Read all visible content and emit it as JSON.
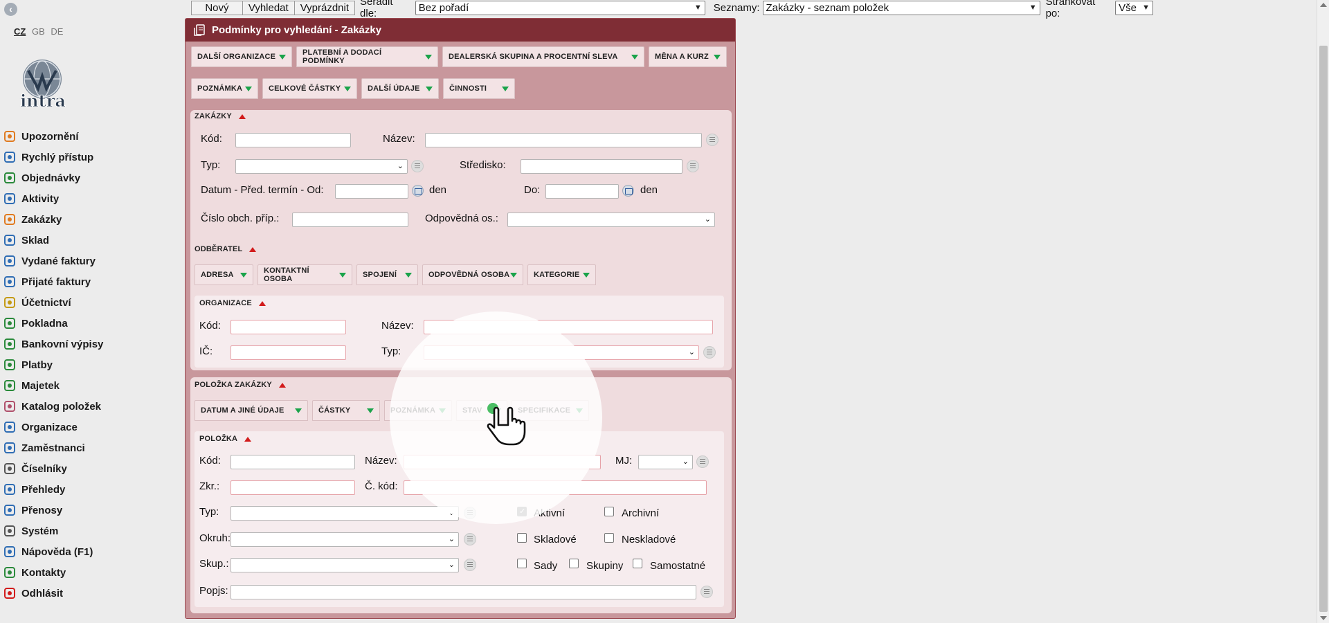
{
  "sidebar": {
    "languages": [
      "CZ",
      "GB",
      "DE"
    ],
    "active_language": "CZ",
    "logo_text": "intra",
    "items": [
      {
        "label": "Upozornění",
        "icon": "bell-icon",
        "color": "#e07a1f"
      },
      {
        "label": "Rychlý přístup",
        "icon": "tiles-icon",
        "color": "#2f6db4"
      },
      {
        "label": "Objednávky",
        "icon": "cart-icon",
        "color": "#2a8a3b"
      },
      {
        "label": "Aktivity",
        "icon": "clock-icon",
        "color": "#2f6db4"
      },
      {
        "label": "Zakázky",
        "icon": "order-icon",
        "color": "#e07a1f"
      },
      {
        "label": "Sklad",
        "icon": "warehouse-icon",
        "color": "#2f6db4"
      },
      {
        "label": "Vydané faktury",
        "icon": "invoice-out-icon",
        "color": "#2f6db4"
      },
      {
        "label": "Přijaté faktury",
        "icon": "invoice-in-icon",
        "color": "#2f6db4"
      },
      {
        "label": "Účetnictví",
        "icon": "ledger-icon",
        "color": "#c49a12"
      },
      {
        "label": "Pokladna",
        "icon": "cashbox-icon",
        "color": "#2a8a3b"
      },
      {
        "label": "Bankovní výpisy",
        "icon": "bank-icon",
        "color": "#2a8a3b"
      },
      {
        "label": "Platby",
        "icon": "coins-icon",
        "color": "#2a8a3b"
      },
      {
        "label": "Majetek",
        "icon": "assets-icon",
        "color": "#2a8a3b"
      },
      {
        "label": "Katalog položek",
        "icon": "tag-icon",
        "color": "#b0506b"
      },
      {
        "label": "Organizace",
        "icon": "building-icon",
        "color": "#2f6db4"
      },
      {
        "label": "Zaměstnanci",
        "icon": "employee-icon",
        "color": "#2f6db4"
      },
      {
        "label": "Číselníky",
        "icon": "gear-icon",
        "color": "#555555"
      },
      {
        "label": "Přehledy",
        "icon": "list-icon",
        "color": "#2f6db4"
      },
      {
        "label": "Přenosy",
        "icon": "sync-icon",
        "color": "#2f6db4"
      },
      {
        "label": "Systém",
        "icon": "wrench-icon",
        "color": "#555555"
      },
      {
        "label": "Nápověda (F1)",
        "icon": "help-icon",
        "color": "#2f6db4"
      },
      {
        "label": "Kontakty",
        "icon": "at-icon",
        "color": "#2a8a3b"
      },
      {
        "label": "Odhlásit",
        "icon": "power-icon",
        "color": "#d21b1b"
      }
    ]
  },
  "toolbar": {
    "new_label": "Nový",
    "search_label": "Vyhledat",
    "clear_label": "Vyprázdnit",
    "sort_label": "Seřadit dle:",
    "sort_value": "Bez pořadí",
    "lists_label": "Seznamy:",
    "lists_value": "Zakázky - seznam položek",
    "paging_label": "Stránkovat po:",
    "paging_value": "Vše"
  },
  "panel": {
    "title": "Podmínky pro vyhledání - Zakázky",
    "tabs_row1": [
      "Další organizace",
      "Platební a dodací podmínky",
      "Dealerská skupina a procentní sleva",
      "Měna a kurz"
    ],
    "tabs_row2": [
      "Poznámka",
      "Celkové částky",
      "Další údaje",
      "Činnosti"
    ],
    "orders": {
      "title": "ZAKÁZKY",
      "code_label": "Kód:",
      "name_label": "Název:",
      "type_label": "Typ:",
      "center_label": "Středisko:",
      "date_label": "Datum - Před. termín - Od:",
      "day_suffix": "den",
      "to_label": "Do:",
      "case_label": "Číslo obch. příp.:",
      "responsible_label": "Odpovědná os.:"
    },
    "customer": {
      "title": "ODBĚRATEL",
      "tabs": [
        "Adresa",
        "Kontaktní osoba",
        "Spojení",
        "Odpovědná osoba",
        "Kategorie"
      ],
      "org_title": "ORGANIZACE",
      "code_label": "Kód:",
      "name_label": "Název:",
      "ic_label": "IČ:",
      "type_label": "Typ:"
    },
    "item_section": {
      "title": "POLOŽKA ZAKÁZKY",
      "tabs": [
        "Datum a jiné údaje",
        "Částky",
        "Poznámka",
        "Stav",
        "Specifikace"
      ],
      "item_title": "POLOŽKA",
      "code_label": "Kód:",
      "name_label": "Název:",
      "unit_label": "MJ:",
      "abbr_label": "Zkr.:",
      "ccode_label": "Č. kód:",
      "type_label": "Typ:",
      "area_label": "Okruh:",
      "group_label": "Skup.:",
      "desc_label": "Popjs:",
      "checkboxes": {
        "active": {
          "label": "Aktivní",
          "checked": true
        },
        "archive": {
          "label": "Archivní",
          "checked": false
        },
        "stock": {
          "label": "Skladové",
          "checked": false
        },
        "nonstock": {
          "label": "Neskladové",
          "checked": false
        },
        "sets": {
          "label": "Sady",
          "checked": false
        },
        "groups": {
          "label": "Skupiny",
          "checked": false
        },
        "single": {
          "label": "Samostatné",
          "checked": false
        }
      }
    }
  }
}
